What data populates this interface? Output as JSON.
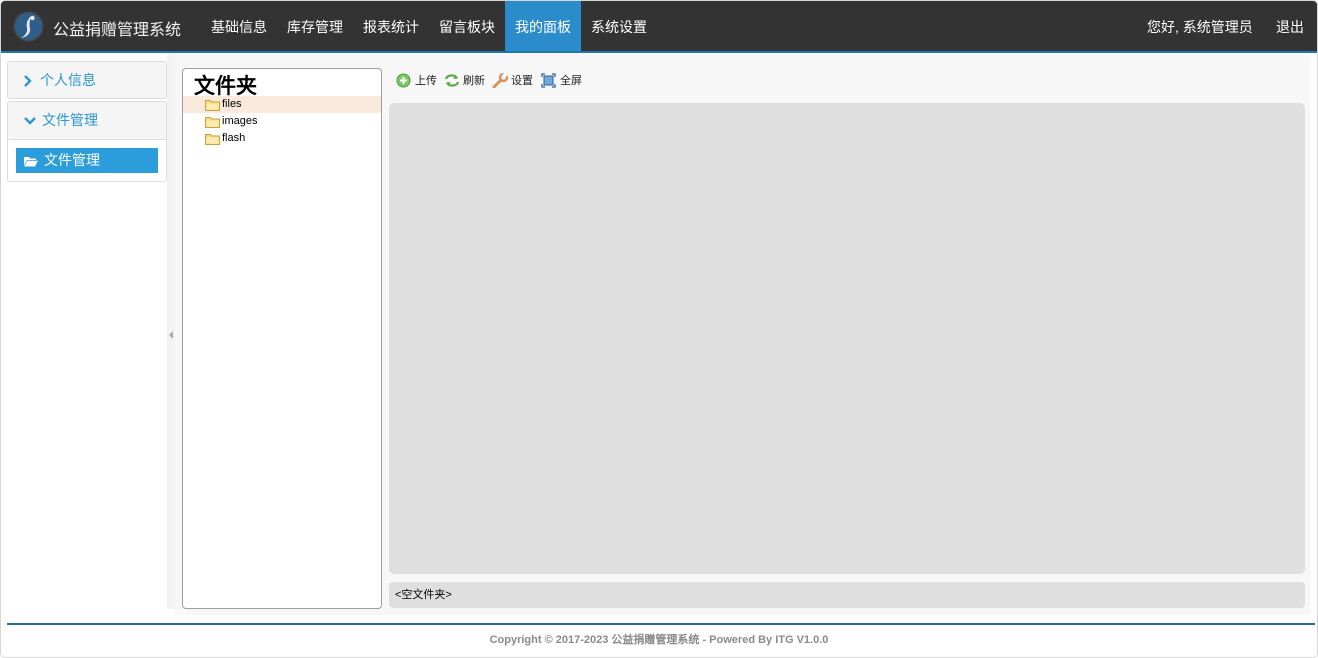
{
  "app": {
    "title": "公益捐赠管理系统"
  },
  "nav": {
    "items": [
      "基础信息",
      "库存管理",
      "报表统计",
      "留言板块",
      "我的面板",
      "系统设置"
    ],
    "active": "我的面板",
    "greeting": "您好, 系统管理员",
    "logout": "退出"
  },
  "sidebar": {
    "panels": [
      {
        "label": "个人信息",
        "icon": "chevron-right-icon",
        "expanded": false
      },
      {
        "label": "文件管理",
        "icon": "chevron-down-icon",
        "expanded": true,
        "items": [
          {
            "label": "文件管理",
            "icon": "folder-open-icon"
          }
        ]
      }
    ]
  },
  "tree": {
    "title": "文件夹",
    "nodes": [
      "files",
      "images",
      "flash"
    ],
    "selected": "files"
  },
  "toolbar": {
    "upload": "上传",
    "refresh": "刷新",
    "settings": "设置",
    "fullscreen": "全屏"
  },
  "status": {
    "text": "<空文件夹>"
  },
  "footer": {
    "text": "Copyright © 2017-2023 公益捐赠管理系统 - Powered By ITG V1.0.0"
  },
  "colors": {
    "navbar": "#333333",
    "nav_active": "#2b8ccc",
    "accent": "#2a96d3",
    "selected_node": "#f9eadb",
    "footer_line": "#1f6f96"
  }
}
